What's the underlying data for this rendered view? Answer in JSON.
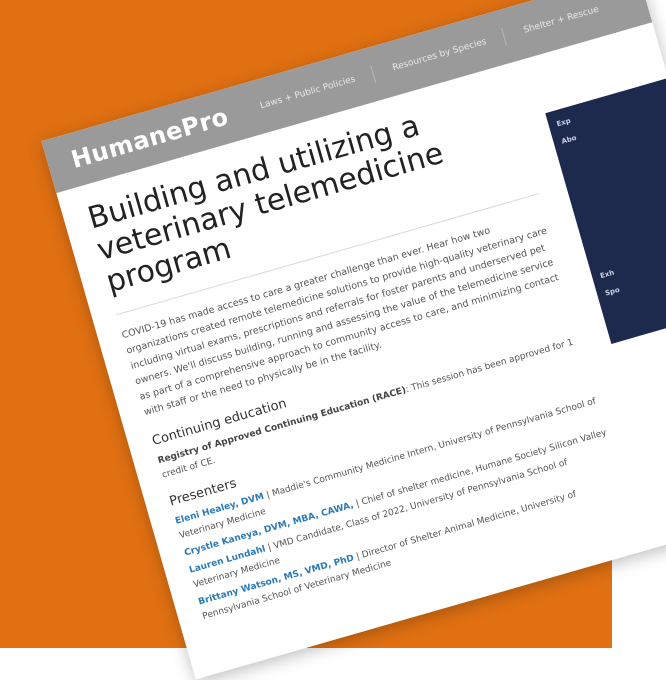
{
  "site": {
    "brand": "HumanePro",
    "nav": [
      "Laws + Public Policies",
      "Resources by Species",
      "Shelter + Rescue"
    ]
  },
  "article": {
    "title": "Building and utilizing a veterinary telemedicine program",
    "description": "COVID-19 has made access to care a greater challenge than ever. Hear how two organizations created remote telemedicine solutions to provide high-quality veterinary care including virtual exams, prescriptions and referrals for foster parents and underserved pet owners. We'll discuss building, running and assessing the value of the telemedicine service as part of a comprehensive approach to community access to care, and minimizing contact with staff or the need to physically be in the facility.",
    "ce_heading": "Continuing education",
    "ce_text_bold": "Registry of Approved Continuing Education (RACE)",
    "ce_text_rest": ": This session has been approved for 1 credit of CE.",
    "presenters_heading": "Presenters",
    "presenters": [
      {
        "name": "Eleni Healey, DVM",
        "detail": " | Maddie's Community Medicine Intern, University of Pennsylvania School of Veterinary Medicine"
      },
      {
        "name": "Crystle Kaneya, DVM, MBA, CAWA,",
        "detail": " | Chief of shelter medicine, Humane Society Silicon Valley"
      },
      {
        "name": "Lauren Lundahl",
        "detail": " | VMD Candidate, Class of 2022, University of Pennsylvania School of Veterinary Medicine"
      },
      {
        "name": "Brittany Watson, MS, VMD, PhD",
        "detail": " | Director of Shelter Animal Medicine, University of Pennsylvania School of Veterinary Medicine"
      }
    ]
  },
  "sidebar": {
    "labels": [
      "Exp",
      "Abo",
      "Exh",
      "Spo"
    ]
  },
  "colors": {
    "background": "#e07012",
    "header": "#9a9a9a",
    "sidebar": "#1d2a4d",
    "link": "#2a7ab8"
  }
}
